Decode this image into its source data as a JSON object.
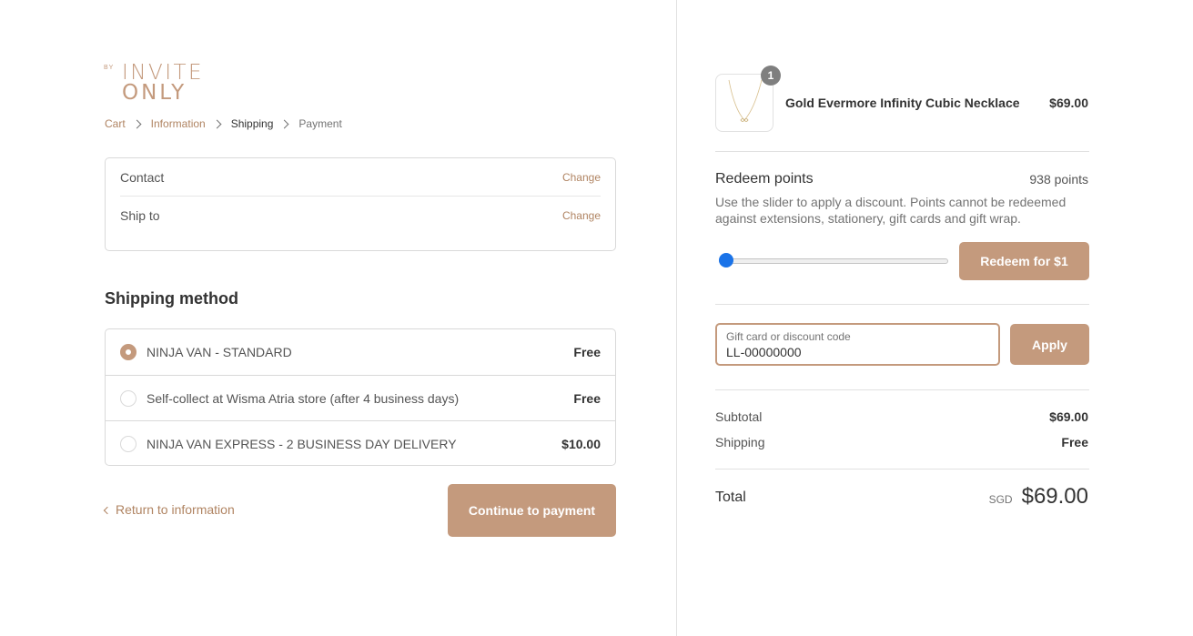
{
  "brand": {
    "logo_by": "BY",
    "logo_line1": "INVITE",
    "logo_line2": "ONLY",
    "accent_color": "#c49a7d"
  },
  "breadcrumb": {
    "cart": "Cart",
    "information": "Information",
    "shipping": "Shipping",
    "payment": "Payment"
  },
  "review": {
    "contact_label": "Contact",
    "ship_to_label": "Ship to",
    "change_label": "Change"
  },
  "shipping_method": {
    "title": "Shipping method",
    "options": [
      {
        "label": "NINJA VAN - STANDARD",
        "price": "Free",
        "selected": true
      },
      {
        "label": "Self-collect at Wisma Atria store (after 4 business days)",
        "price": "Free",
        "selected": false
      },
      {
        "label": "NINJA VAN EXPRESS - 2 BUSINESS DAY DELIVERY",
        "price": "$10.00",
        "selected": false
      }
    ]
  },
  "actions": {
    "return_label": "Return to information",
    "continue_label": "Continue to payment"
  },
  "order": {
    "product": {
      "name": "Gold Evermore Infinity Cubic Necklace",
      "price": "$69.00",
      "quantity": "1"
    },
    "redeem": {
      "title": "Redeem points",
      "points": "938 points",
      "description": "Use the slider to apply a discount. Points cannot be redeemed against extensions, stationery, gift cards and gift wrap.",
      "slider_fraction": 0.0,
      "button_label": "Redeem for $1"
    },
    "discount": {
      "label": "Gift card or discount code",
      "value": "LL-00000000",
      "apply_label": "Apply"
    },
    "subtotal_label": "Subtotal",
    "subtotal_value": "$69.00",
    "shipping_label": "Shipping",
    "shipping_value": "Free",
    "total_label": "Total",
    "currency": "SGD",
    "total_value": "$69.00"
  }
}
